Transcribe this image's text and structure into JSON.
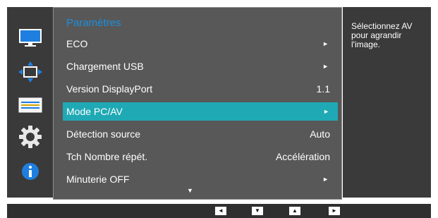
{
  "menu": {
    "title": "Paramètres",
    "items": [
      {
        "label": "ECO",
        "value": "",
        "arrow": "►",
        "selected": false
      },
      {
        "label": "Chargement USB",
        "value": "",
        "arrow": "►",
        "selected": false
      },
      {
        "label": "Version DisplayPort",
        "value": "1.1",
        "arrow": "",
        "selected": false
      },
      {
        "label": "Mode PC/AV",
        "value": "",
        "arrow": "►",
        "selected": true
      },
      {
        "label": "Détection source",
        "value": "Auto",
        "arrow": "",
        "selected": false
      },
      {
        "label": "Tch Nombre répét.",
        "value": "Accélération",
        "arrow": "",
        "selected": false
      },
      {
        "label": "Minuterie OFF",
        "value": "",
        "arrow": "►",
        "selected": false
      }
    ],
    "more_indicator": "▼"
  },
  "help_text": "Sélectionnez AV pour agrandir l'image.",
  "sidebar_icons": [
    "monitor-icon",
    "position-arrows-icon",
    "settings-bars-icon",
    "gear-icon",
    "info-icon"
  ],
  "nav_buttons": [
    {
      "name": "left-button",
      "glyph": "◄"
    },
    {
      "name": "down-button",
      "glyph": "▼"
    },
    {
      "name": "up-button",
      "glyph": "▲"
    },
    {
      "name": "right-button",
      "glyph": "►"
    }
  ],
  "colors": {
    "title": "#1c8ede",
    "selected_row": "#1fa9b4",
    "panel": "#585858",
    "side_panels": "#3a3a3a"
  }
}
